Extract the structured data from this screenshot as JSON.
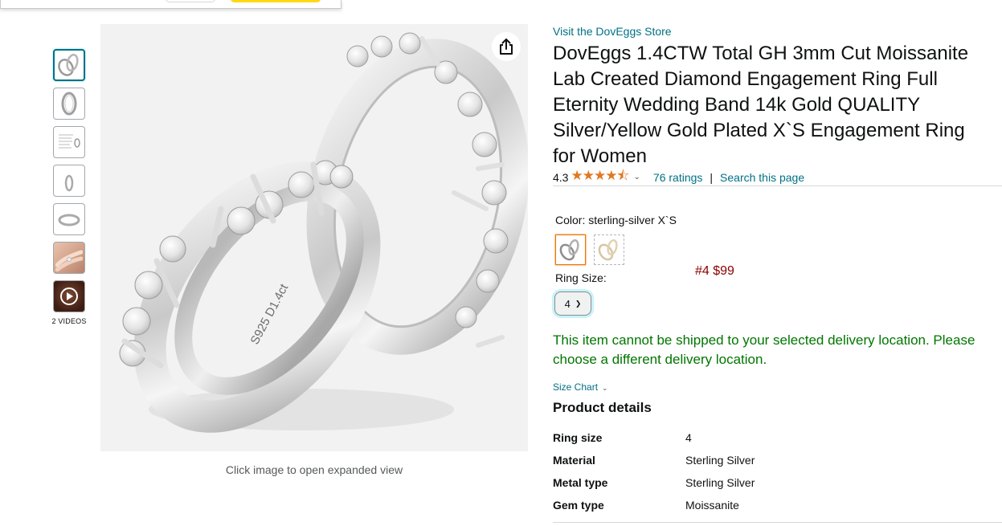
{
  "thumbnails": {
    "items": [
      {
        "kind": "ring-pair",
        "selected": true
      },
      {
        "kind": "ring-upright",
        "selected": false
      },
      {
        "kind": "size-chart",
        "selected": false
      },
      {
        "kind": "ring-side",
        "selected": false
      },
      {
        "kind": "ring-flat",
        "selected": false
      },
      {
        "kind": "on-hand",
        "selected": false
      },
      {
        "kind": "video",
        "selected": false
      }
    ],
    "videos_label": "2 VIDEOS"
  },
  "main_image": {
    "caption": "Click image to open expanded view",
    "engraving": "S925 D1.4ct"
  },
  "product": {
    "store_link": "Visit the DovEggs Store",
    "title": "DovEggs 1.4CTW Total GH 3mm Cut Moissanite Lab Created Diamond Engagement Ring Full Eternity Wedding Band 14k Gold QUALITY Silver/Yellow Gold Plated X`S Engagement Ring for Women",
    "rating_value": "4.3",
    "stars": "★★★★⯪",
    "ratings_link": "76 ratings",
    "separator": "|",
    "search_link": "Search this page"
  },
  "color": {
    "label": "Color: sterling-silver X`S"
  },
  "size": {
    "label": "Ring Size:",
    "price_note": "#4 $99",
    "selected": "4"
  },
  "shipping": {
    "message": "This item cannot be shipped to your selected delivery location. Please choose a different delivery location."
  },
  "size_chart": {
    "label": "Size Chart"
  },
  "details": {
    "heading": "Product details",
    "rows": [
      {
        "key": "Ring size",
        "value": "4"
      },
      {
        "key": "Material",
        "value": "Sterling Silver"
      },
      {
        "key": "Metal type",
        "value": "Sterling Silver"
      },
      {
        "key": "Gem type",
        "value": "Moissanite"
      }
    ]
  },
  "colors": {
    "link": "#007185",
    "success": "#007600",
    "star": "#de7921",
    "price": "#8b0000"
  }
}
